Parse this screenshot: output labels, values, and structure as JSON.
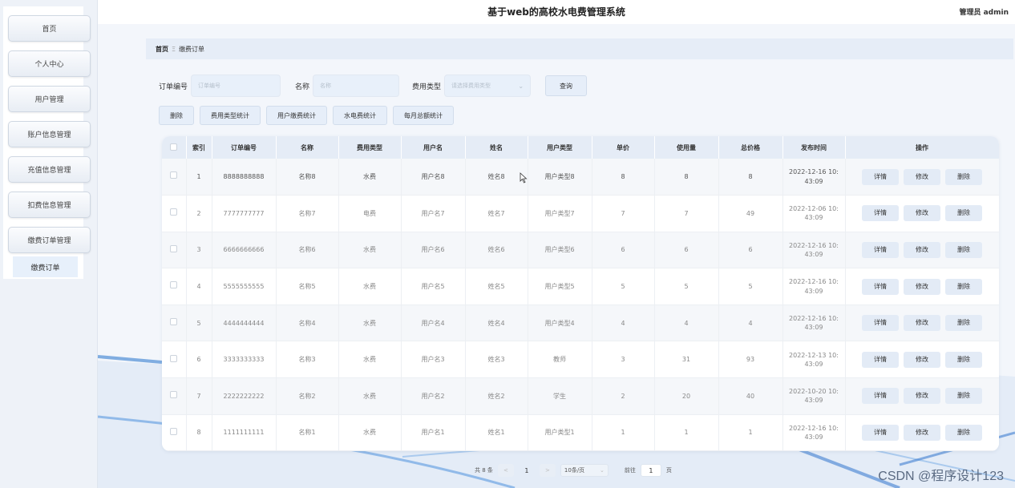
{
  "sidebar": {
    "items": [
      {
        "label": "首页"
      },
      {
        "label": "个人中心"
      },
      {
        "label": "用户管理"
      },
      {
        "label": "账户信息管理"
      },
      {
        "label": "充值信息管理"
      },
      {
        "label": "扣费信息管理"
      },
      {
        "label": "缴费订单管理"
      }
    ],
    "sub_item": "缴费订单"
  },
  "header": {
    "title": "基于web的高校水电费管理系统",
    "user": "管理员 admin"
  },
  "breadcrumb": {
    "home": "首页",
    "separator": "Ξ",
    "current": "缴费订单"
  },
  "search": {
    "order_label": "订单编号",
    "order_placeholder": "订单编号",
    "name_label": "名称",
    "name_placeholder": "名称",
    "type_label": "费用类型",
    "type_placeholder": "请选择费用类型",
    "query_label": "查询"
  },
  "actions": {
    "delete": "删除",
    "fee_type_stats": "费用类型统计",
    "user_payment_stats": "用户缴费统计",
    "water_elec_stats": "水电费统计",
    "monthly_total_stats": "每月总额统计"
  },
  "table": {
    "headers": [
      "索引",
      "订单编号",
      "名称",
      "费用类型",
      "用户名",
      "姓名",
      "用户类型",
      "单价",
      "使用量",
      "总价格",
      "发布时间",
      "操作"
    ],
    "op_labels": {
      "detail": "详情",
      "edit": "修改",
      "delete": "删除"
    },
    "rows": [
      {
        "idx": "1",
        "order": "8888888888",
        "name": "名称8",
        "type": "水费",
        "username": "用户名8",
        "realname": "姓名8",
        "usertype": "用户类型8",
        "price": "8",
        "usage": "8",
        "total": "8",
        "time_a": "2022-12-16 10:",
        "time_b": "43:09"
      },
      {
        "idx": "2",
        "order": "7777777777",
        "name": "名称7",
        "type": "电费",
        "username": "用户名7",
        "realname": "姓名7",
        "usertype": "用户类型7",
        "price": "7",
        "usage": "7",
        "total": "49",
        "time_a": "2022-12-06 10:",
        "time_b": "43:09"
      },
      {
        "idx": "3",
        "order": "6666666666",
        "name": "名称6",
        "type": "水费",
        "username": "用户名6",
        "realname": "姓名6",
        "usertype": "用户类型6",
        "price": "6",
        "usage": "6",
        "total": "6",
        "time_a": "2022-12-16 10:",
        "time_b": "43:09"
      },
      {
        "idx": "4",
        "order": "5555555555",
        "name": "名称5",
        "type": "水费",
        "username": "用户名5",
        "realname": "姓名5",
        "usertype": "用户类型5",
        "price": "5",
        "usage": "5",
        "total": "5",
        "time_a": "2022-12-16 10:",
        "time_b": "43:09"
      },
      {
        "idx": "5",
        "order": "4444444444",
        "name": "名称4",
        "type": "水费",
        "username": "用户名4",
        "realname": "姓名4",
        "usertype": "用户类型4",
        "price": "4",
        "usage": "4",
        "total": "4",
        "time_a": "2022-12-16 10:",
        "time_b": "43:09"
      },
      {
        "idx": "6",
        "order": "3333333333",
        "name": "名称3",
        "type": "水费",
        "username": "用户名3",
        "realname": "姓名3",
        "usertype": "教师",
        "price": "3",
        "usage": "31",
        "total": "93",
        "time_a": "2022-12-13 10:",
        "time_b": "43:09"
      },
      {
        "idx": "7",
        "order": "2222222222",
        "name": "名称2",
        "type": "水费",
        "username": "用户名2",
        "realname": "姓名2",
        "usertype": "学生",
        "price": "2",
        "usage": "20",
        "total": "40",
        "time_a": "2022-10-20 10:",
        "time_b": "43:09"
      },
      {
        "idx": "8",
        "order": "1111111111",
        "name": "名称1",
        "type": "水费",
        "username": "用户名1",
        "realname": "姓名1",
        "usertype": "用户类型1",
        "price": "1",
        "usage": "1",
        "total": "1",
        "time_a": "2022-12-16 10:",
        "time_b": "43:09"
      }
    ]
  },
  "pagination": {
    "total": "共 8 条",
    "prev": "<",
    "current_page": "1",
    "next": ">",
    "page_size": "10条/页",
    "goto_label": "前往",
    "goto_value": "1",
    "page_suffix": "页"
  },
  "watermark": "CSDN @程序设计123"
}
